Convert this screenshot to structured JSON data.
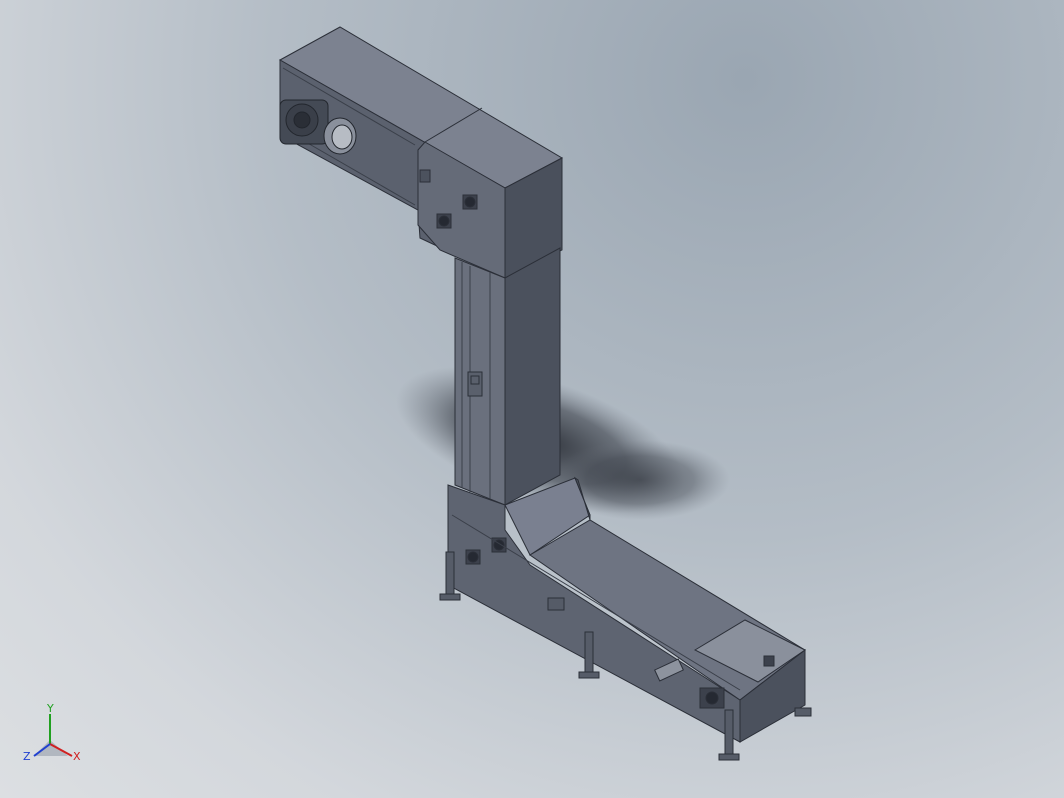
{
  "view": {
    "background_top": "#9aa6b2",
    "background_bottom": "#dcdfe2",
    "model_color": "#5d6371"
  },
  "triad": {
    "x_label": "X",
    "y_label": "Y",
    "z_label": "Z",
    "x_color": "#d02020",
    "y_color": "#20a020",
    "z_color": "#2040d0"
  }
}
